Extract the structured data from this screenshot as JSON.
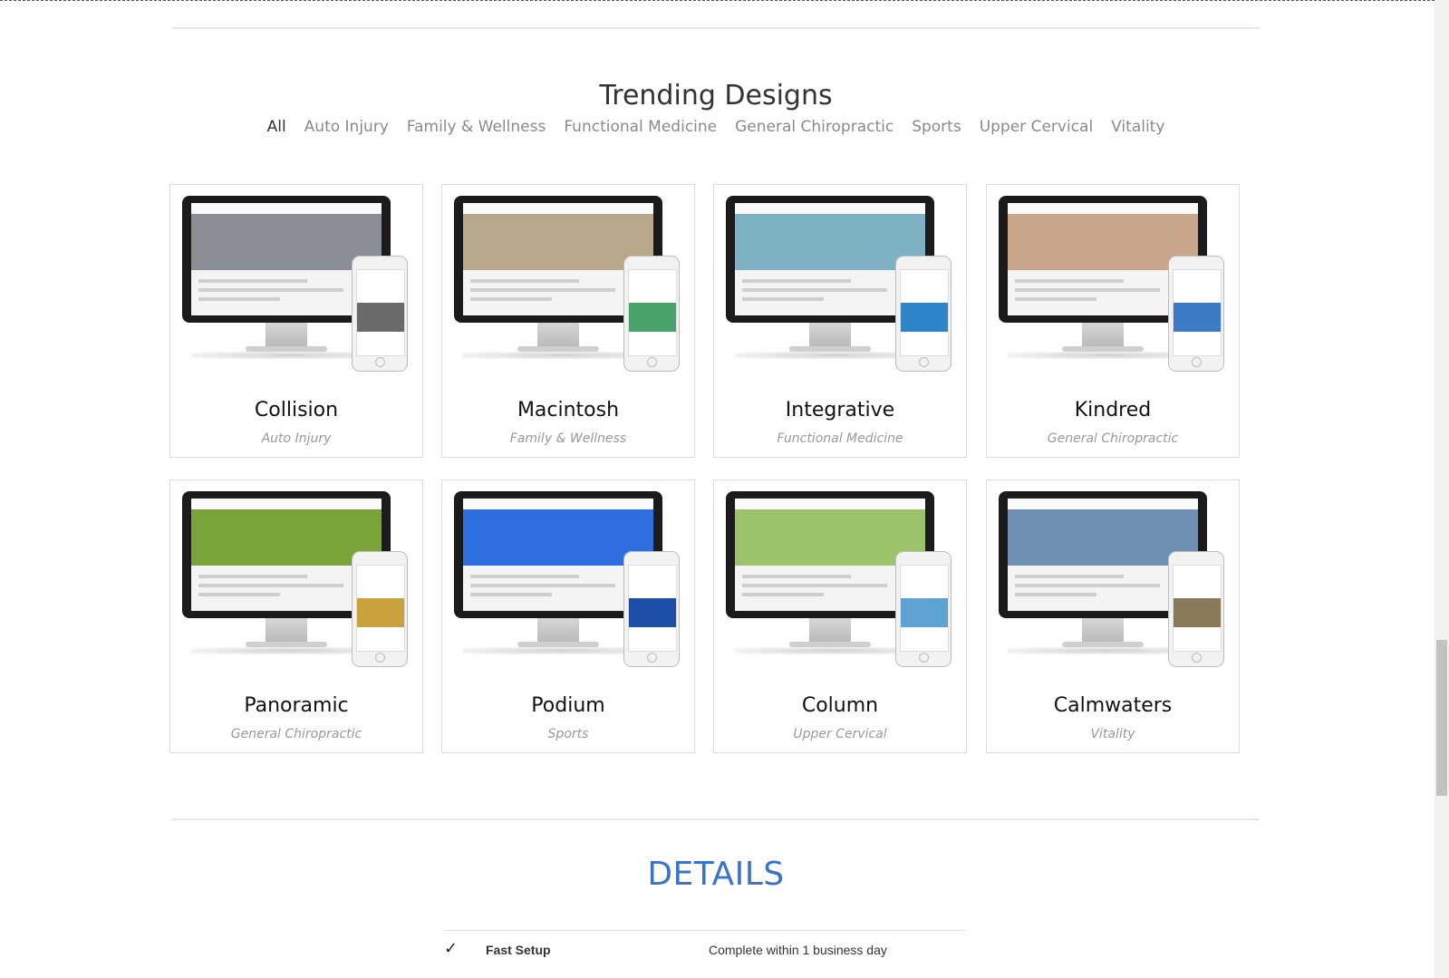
{
  "section": {
    "title": "Trending Designs",
    "filters": [
      "All",
      "Auto Injury",
      "Family & Wellness",
      "Functional Medicine",
      "General Chiropractic",
      "Sports",
      "Upper Cervical",
      "Vitality"
    ],
    "active_filter": "All"
  },
  "designs": [
    {
      "name": "Collision",
      "category": "Auto Injury",
      "hero_color": "#8a8f96",
      "phone_color": "#6b6b6b"
    },
    {
      "name": "Macintosh",
      "category": "Family & Wellness",
      "hero_color": "#b8a98a",
      "phone_color": "#4aa36b"
    },
    {
      "name": "Integrative",
      "category": "Functional Medicine",
      "hero_color": "#7fb1c4",
      "phone_color": "#2e86c9"
    },
    {
      "name": "Kindred",
      "category": "General Chiropractic",
      "hero_color": "#c9a68a",
      "phone_color": "#3b7bc4"
    },
    {
      "name": "Panoramic",
      "category": "General Chiropractic",
      "hero_color": "#7aa33a",
      "phone_color": "#c9a23d"
    },
    {
      "name": "Podium",
      "category": "Sports",
      "hero_color": "#2f6ee0",
      "phone_color": "#1d4ea8"
    },
    {
      "name": "Column",
      "category": "Upper Cervical",
      "hero_color": "#9cc36a",
      "phone_color": "#5fa3d4"
    },
    {
      "name": "Calmwaters",
      "category": "Vitality",
      "hero_color": "#6f8fb3",
      "phone_color": "#8a7a5a"
    }
  ],
  "details": {
    "title": "DETAILS",
    "rows": [
      {
        "check": "✓",
        "label": "Fast Setup",
        "value": "Complete within 1 business day"
      }
    ]
  }
}
